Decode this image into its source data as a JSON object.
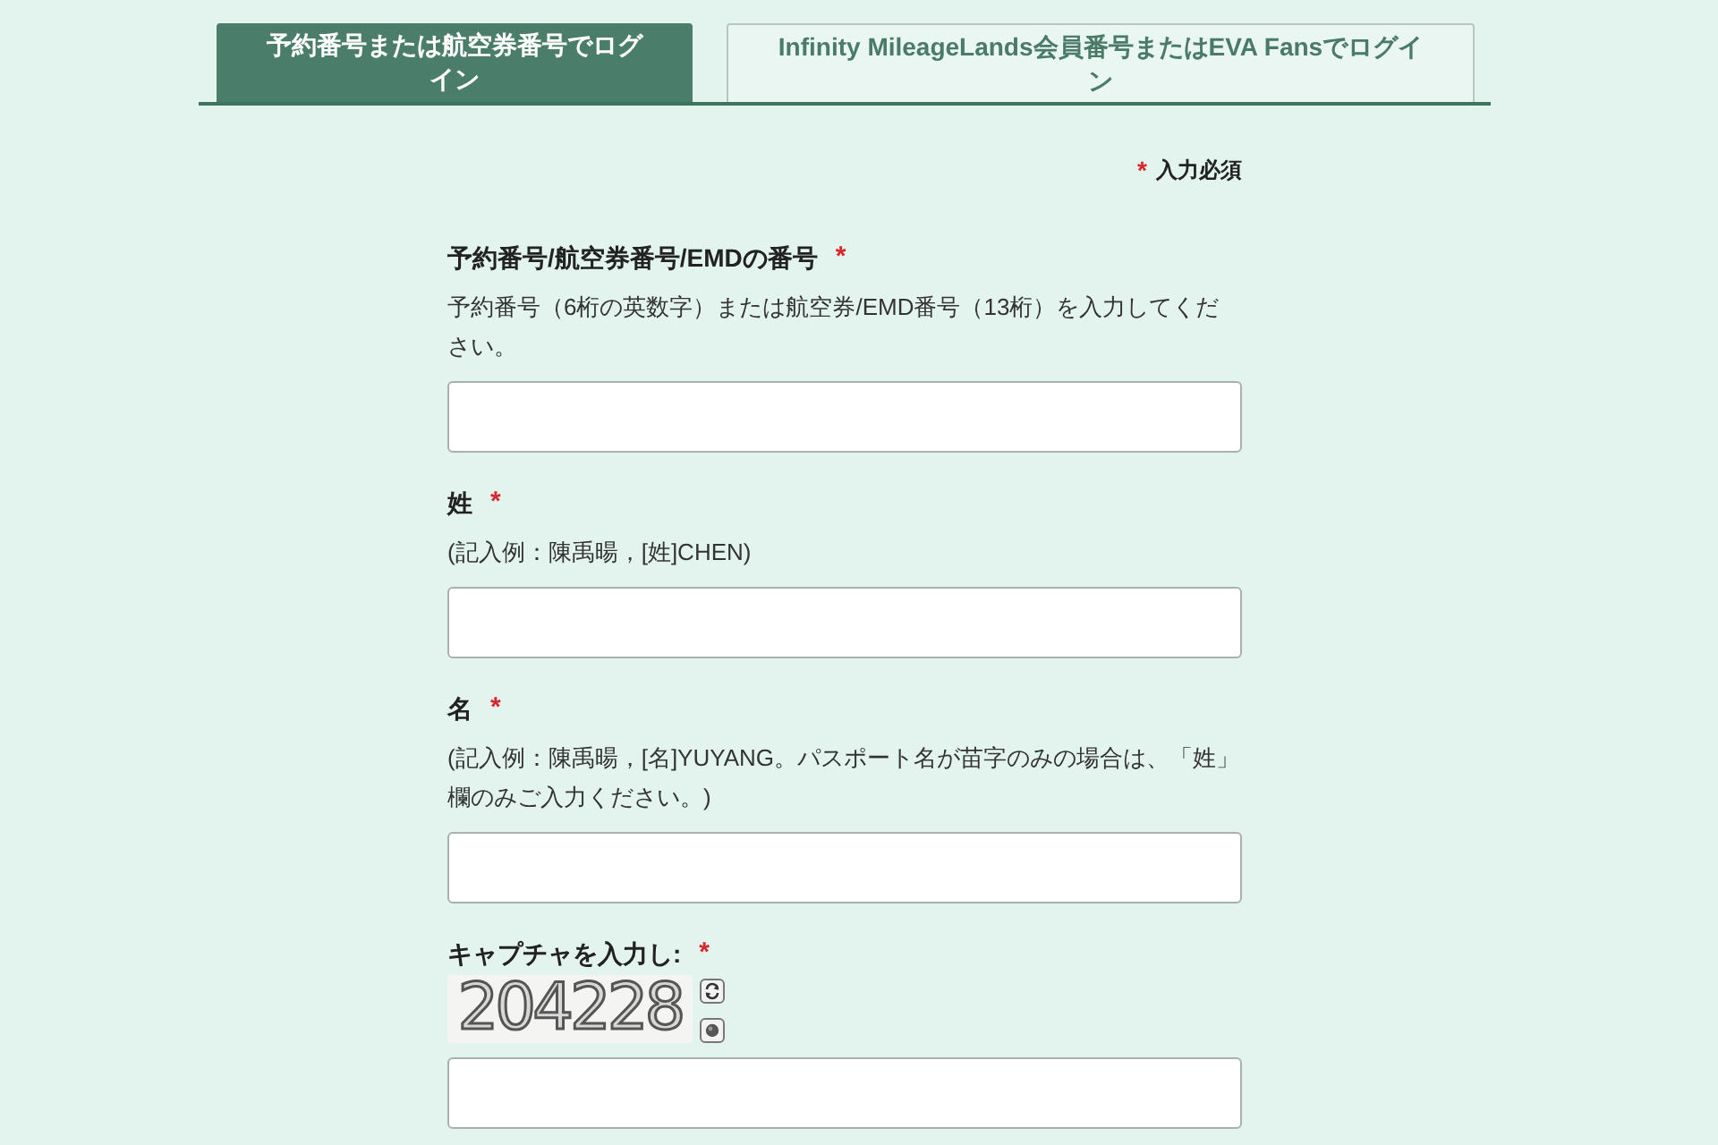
{
  "tabs": [
    {
      "label": "予約番号または航空券番号でログイン",
      "selected": true
    },
    {
      "label": "Infinity MileageLands会員番号またはEVA Fansでログイン",
      "selected": false
    }
  ],
  "required_note": {
    "mark": "*",
    "text": "入力必須"
  },
  "fields": [
    {
      "kind": "text",
      "label": "予約番号/航空券番号/EMDの番号",
      "required_mark": "*",
      "hint": "予約番号（6桁の英数字）または航空券/EMD番号（13桁）を入力してください。"
    },
    {
      "kind": "text",
      "label": "姓",
      "required_mark": "*",
      "hint": "(記入例：陳禹暘，[姓]CHEN)"
    },
    {
      "kind": "text",
      "label": "名",
      "required_mark": "*",
      "hint": "(記入例：陳禹暘，[名]YUYANG。パスポート名が苗字のみの場合は、「姓」欄のみご入力ください。)"
    },
    {
      "kind": "captcha",
      "label": "キャプチャを入力し:",
      "required_mark": "*",
      "captcha": "204228"
    }
  ]
}
